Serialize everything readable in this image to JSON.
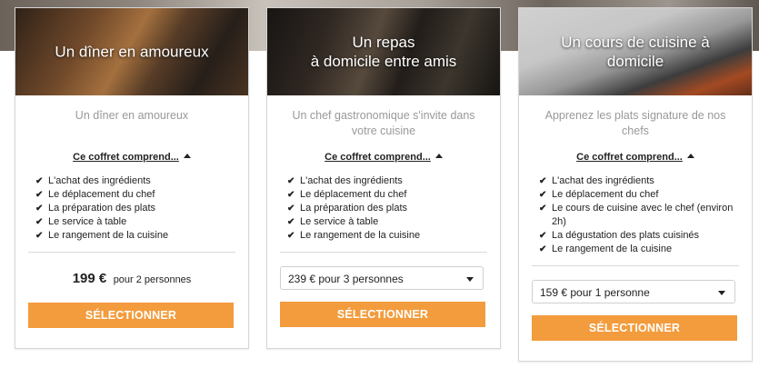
{
  "offers": [
    {
      "photo_title": "Un dîner en amoureux",
      "subtitle": "Un dîner en amoureux",
      "coffret_label": "Ce coffret comprend...",
      "features": [
        "L'achat des ingrédients",
        "Le déplacement du chef",
        "La préparation des plats",
        "Le service à table",
        "Le rangement de la cuisine"
      ],
      "price_amount": "199 €",
      "price_persons": "pour 2 personnes",
      "button_label": "SÉLECTIONNER"
    },
    {
      "photo_title": "Un repas\nà domicile entre amis",
      "subtitle": "Un chef gastronomique s'invite dans\nvotre cuisine",
      "coffret_label": "Ce coffret comprend...",
      "features": [
        "L'achat des ingrédients",
        "Le déplacement du chef",
        "La préparation des plats",
        "Le service à table",
        "Le rangement de la cuisine"
      ],
      "select_value": "239 € pour 3 personnes",
      "button_label": "SÉLECTIONNER"
    },
    {
      "photo_title": "Un cours de cuisine à\ndomicile",
      "subtitle": "Apprenez les plats signature de nos\nchefs",
      "coffret_label": "Ce coffret comprend...",
      "features": [
        "L'achat des ingrédients",
        "Le déplacement du chef",
        "Le cours de cuisine avec le chef (environ 2h)",
        "La dégustation des plats cuisinés",
        "Le rangement de la cuisine"
      ],
      "select_value": "159 € pour 1 personne",
      "button_label": "SÉLECTIONNER"
    }
  ],
  "colors": {
    "accent": "#f39c3d",
    "card_border": "#d6d6d6"
  },
  "icons": {
    "check": "check-icon",
    "caret_up": "caret-up-icon",
    "dropdown": "chevron-down-icon"
  }
}
